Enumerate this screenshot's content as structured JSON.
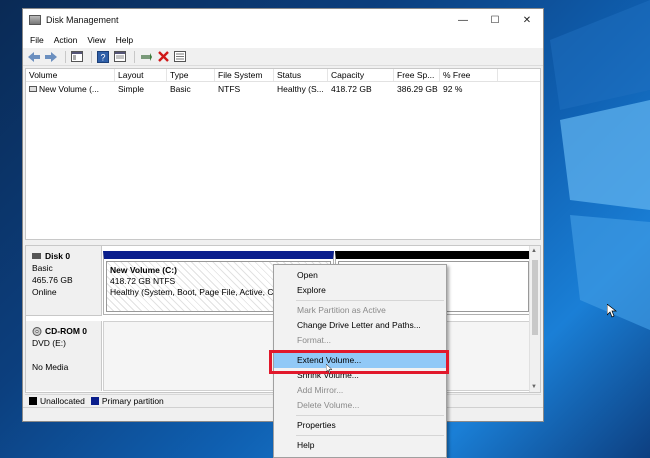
{
  "window": {
    "title": "Disk Management",
    "controls": {
      "minimize": "—",
      "maximize": "☐",
      "close": "✕"
    }
  },
  "menu": [
    "File",
    "Action",
    "View",
    "Help"
  ],
  "volume_table": {
    "columns": [
      "Volume",
      "Layout",
      "Type",
      "File System",
      "Status",
      "Capacity",
      "Free Sp...",
      "% Free"
    ],
    "rows": [
      [
        "New Volume (...",
        "Simple",
        "Basic",
        "NTFS",
        "Healthy (S...",
        "418.72 GB",
        "386.29 GB",
        "92 %"
      ]
    ]
  },
  "disks": [
    {
      "name": "Disk 0",
      "type": "Basic",
      "size": "465.76 GB",
      "status": "Online",
      "partition": {
        "name": "New Volume  (C:)",
        "size_fs": "418.72 GB NTFS",
        "status": "Healthy (System, Boot, Page File, Active, Crash"
      }
    },
    {
      "name": "CD-ROM 0",
      "type": "DVD (E:)",
      "status": "No Media"
    }
  ],
  "legend": {
    "unallocated": "Unallocated",
    "primary": "Primary partition"
  },
  "context_menu": [
    {
      "label": "Open",
      "enabled": true
    },
    {
      "label": "Explore",
      "enabled": true
    },
    {
      "label": "Mark Partition as Active",
      "enabled": false
    },
    {
      "label": "Change Drive Letter and Paths...",
      "enabled": true
    },
    {
      "label": "Format...",
      "enabled": false
    },
    {
      "label": "Extend Volume...",
      "enabled": true,
      "highlighted": true
    },
    {
      "label": "Shrink Volume...",
      "enabled": true
    },
    {
      "label": "Add Mirror...",
      "enabled": false
    },
    {
      "label": "Delete Volume...",
      "enabled": false
    },
    {
      "label": "Properties",
      "enabled": true
    },
    {
      "label": "Help",
      "enabled": true
    }
  ],
  "colors": {
    "primary_partition": "#0a1e8c",
    "unallocated": "#000000",
    "highlight_box": "#e1182b",
    "menu_highlight": "#91c9f7"
  }
}
